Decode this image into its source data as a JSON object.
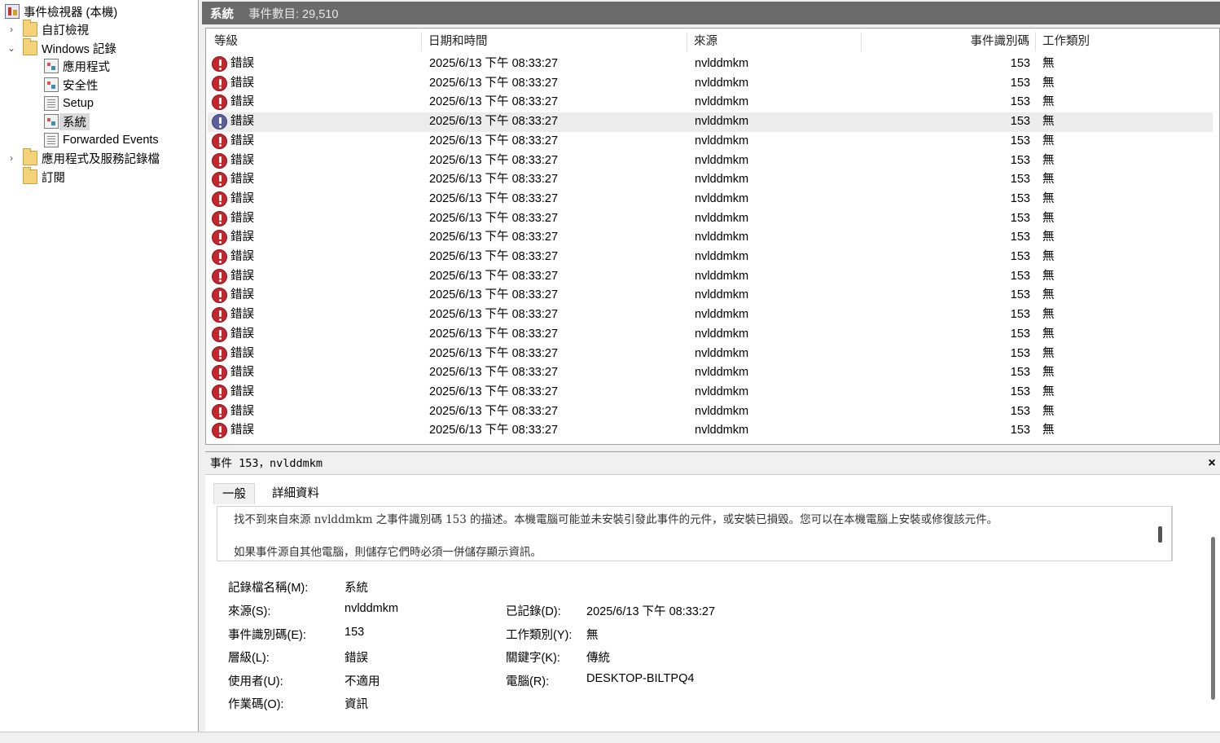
{
  "tree": {
    "root": "事件檢視器 (本機)",
    "custom_views": "自訂檢視",
    "windows_logs": "Windows 記錄",
    "app": "應用程式",
    "security": "安全性",
    "setup": "Setup",
    "system": "系統",
    "forwarded": "Forwarded Events",
    "app_service_logs": "應用程式及服務記錄檔",
    "subscriptions": "訂閱"
  },
  "header": {
    "title": "系統",
    "count": "事件數目: 29,510"
  },
  "columns": {
    "level": "等級",
    "datetime": "日期和時間",
    "source": "來源",
    "event_id": "事件識別碼",
    "task_category": "工作類別"
  },
  "events": [
    {
      "level": "錯誤",
      "datetime": "2025/6/13 下午 08:33:27",
      "source": "nvlddmkm",
      "event_id": "153",
      "task": "無"
    },
    {
      "level": "錯誤",
      "datetime": "2025/6/13 下午 08:33:27",
      "source": "nvlddmkm",
      "event_id": "153",
      "task": "無"
    },
    {
      "level": "錯誤",
      "datetime": "2025/6/13 下午 08:33:27",
      "source": "nvlddmkm",
      "event_id": "153",
      "task": "無"
    },
    {
      "level": "錯誤",
      "datetime": "2025/6/13 下午 08:33:27",
      "source": "nvlddmkm",
      "event_id": "153",
      "task": "無"
    },
    {
      "level": "錯誤",
      "datetime": "2025/6/13 下午 08:33:27",
      "source": "nvlddmkm",
      "event_id": "153",
      "task": "無"
    },
    {
      "level": "錯誤",
      "datetime": "2025/6/13 下午 08:33:27",
      "source": "nvlddmkm",
      "event_id": "153",
      "task": "無"
    },
    {
      "level": "錯誤",
      "datetime": "2025/6/13 下午 08:33:27",
      "source": "nvlddmkm",
      "event_id": "153",
      "task": "無"
    },
    {
      "level": "錯誤",
      "datetime": "2025/6/13 下午 08:33:27",
      "source": "nvlddmkm",
      "event_id": "153",
      "task": "無"
    },
    {
      "level": "錯誤",
      "datetime": "2025/6/13 下午 08:33:27",
      "source": "nvlddmkm",
      "event_id": "153",
      "task": "無"
    },
    {
      "level": "錯誤",
      "datetime": "2025/6/13 下午 08:33:27",
      "source": "nvlddmkm",
      "event_id": "153",
      "task": "無"
    },
    {
      "level": "錯誤",
      "datetime": "2025/6/13 下午 08:33:27",
      "source": "nvlddmkm",
      "event_id": "153",
      "task": "無"
    },
    {
      "level": "錯誤",
      "datetime": "2025/6/13 下午 08:33:27",
      "source": "nvlddmkm",
      "event_id": "153",
      "task": "無"
    },
    {
      "level": "錯誤",
      "datetime": "2025/6/13 下午 08:33:27",
      "source": "nvlddmkm",
      "event_id": "153",
      "task": "無"
    },
    {
      "level": "錯誤",
      "datetime": "2025/6/13 下午 08:33:27",
      "source": "nvlddmkm",
      "event_id": "153",
      "task": "無"
    },
    {
      "level": "錯誤",
      "datetime": "2025/6/13 下午 08:33:27",
      "source": "nvlddmkm",
      "event_id": "153",
      "task": "無"
    },
    {
      "level": "錯誤",
      "datetime": "2025/6/13 下午 08:33:27",
      "source": "nvlddmkm",
      "event_id": "153",
      "task": "無"
    },
    {
      "level": "錯誤",
      "datetime": "2025/6/13 下午 08:33:27",
      "source": "nvlddmkm",
      "event_id": "153",
      "task": "無"
    },
    {
      "level": "錯誤",
      "datetime": "2025/6/13 下午 08:33:27",
      "source": "nvlddmkm",
      "event_id": "153",
      "task": "無"
    },
    {
      "level": "錯誤",
      "datetime": "2025/6/13 下午 08:33:27",
      "source": "nvlddmkm",
      "event_id": "153",
      "task": "無"
    },
    {
      "level": "錯誤",
      "datetime": "2025/6/13 下午 08:33:27",
      "source": "nvlddmkm",
      "event_id": "153",
      "task": "無"
    }
  ],
  "detail": {
    "title": "事件 153，nvlddmkm",
    "close": "×",
    "tab_general": "一般",
    "tab_details": "詳細資料",
    "desc_line1": "找不到來自來源 nvlddmkm 之事件識別碼 153 的描述。本機電腦可能並未安裝引發此事件的元件，或安裝已損毀。您可以在本機電腦上安裝或修復該元件。",
    "desc_line2": "如果事件源自其他電腦，則儲存它們時必須一併儲存顯示資訊。",
    "log_name_label": "記錄檔名稱(M):",
    "log_name": "系統",
    "source_label": "來源(S):",
    "source": "nvlddmkm",
    "logged_label": "已記錄(D):",
    "logged": "2025/6/13 下午 08:33:27",
    "event_id_label": "事件識別碼(E):",
    "event_id": "153",
    "task_label": "工作類別(Y):",
    "task": "無",
    "level_label": "層級(L):",
    "level": "錯誤",
    "keywords_label": "關鍵字(K):",
    "keywords": "傳統",
    "user_label": "使用者(U):",
    "user": "不適用",
    "computer_label": "電腦(R):",
    "computer": "DESKTOP-BILTPQ4",
    "opcode_label": "作業碼(O):",
    "opcode": "資訊"
  },
  "selected_row": 3
}
